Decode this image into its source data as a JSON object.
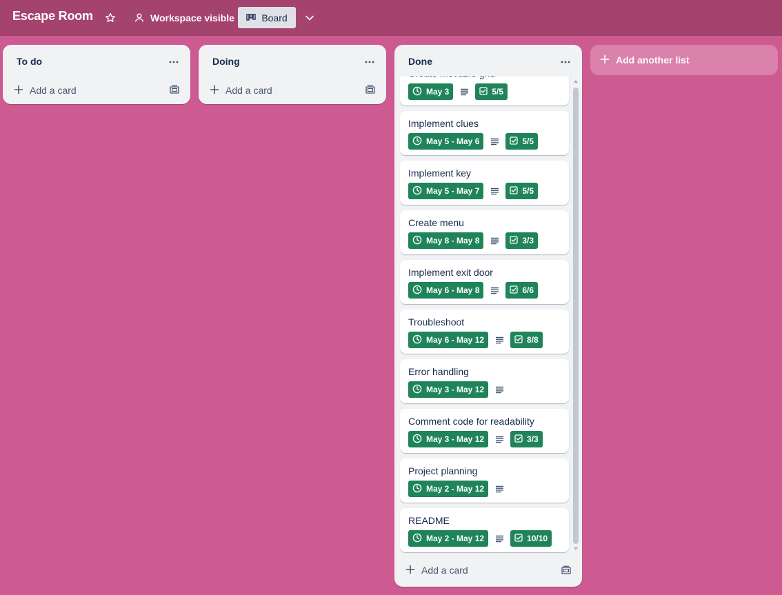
{
  "header": {
    "board_title": "Escape Room",
    "visibility_label": "Workspace visible",
    "view_label": "Board"
  },
  "colors": {
    "board_background": "#cd5a91",
    "header_background": "#a5436f",
    "badge_green": "#1f845a"
  },
  "lists": {
    "todo": {
      "title": "To do",
      "add_card": "Add a card"
    },
    "doing": {
      "title": "Doing",
      "add_card": "Add a card"
    },
    "done": {
      "title": "Done",
      "add_card": "Add a card",
      "cards": [
        {
          "title": "Create movable grid",
          "date": "May 3",
          "checklist": "5/5"
        },
        {
          "title": "Implement clues",
          "date": "May 5 - May 6",
          "checklist": "5/5"
        },
        {
          "title": "Implement key",
          "date": "May 5 - May 7",
          "checklist": "5/5"
        },
        {
          "title": "Create menu",
          "date": "May 8 - May 8",
          "checklist": "3/3"
        },
        {
          "title": "Implement exit door",
          "date": "May 6 - May 8",
          "checklist": "6/6"
        },
        {
          "title": "Troubleshoot",
          "date": "May 6 - May 12",
          "checklist": "8/8"
        },
        {
          "title": "Error handling",
          "date": "May 3 - May 12",
          "checklist": ""
        },
        {
          "title": "Comment code for readability",
          "date": "May 3 - May 12",
          "checklist": "3/3"
        },
        {
          "title": "Project planning",
          "date": "May 2 - May 12",
          "checklist": ""
        },
        {
          "title": "README",
          "date": "May 2 - May 12",
          "checklist": "10/10"
        }
      ]
    }
  },
  "add_list_label": "Add another list",
  "icons": {
    "star": "star-icon",
    "visibility": "people-icon",
    "view": "board-icon",
    "chevron": "chevron-down-icon",
    "list_menu": "more-horizontal-icon",
    "add": "plus-icon",
    "template": "card-template-icon",
    "clock": "clock-icon",
    "description": "description-icon",
    "checklist": "checkbox-icon"
  }
}
